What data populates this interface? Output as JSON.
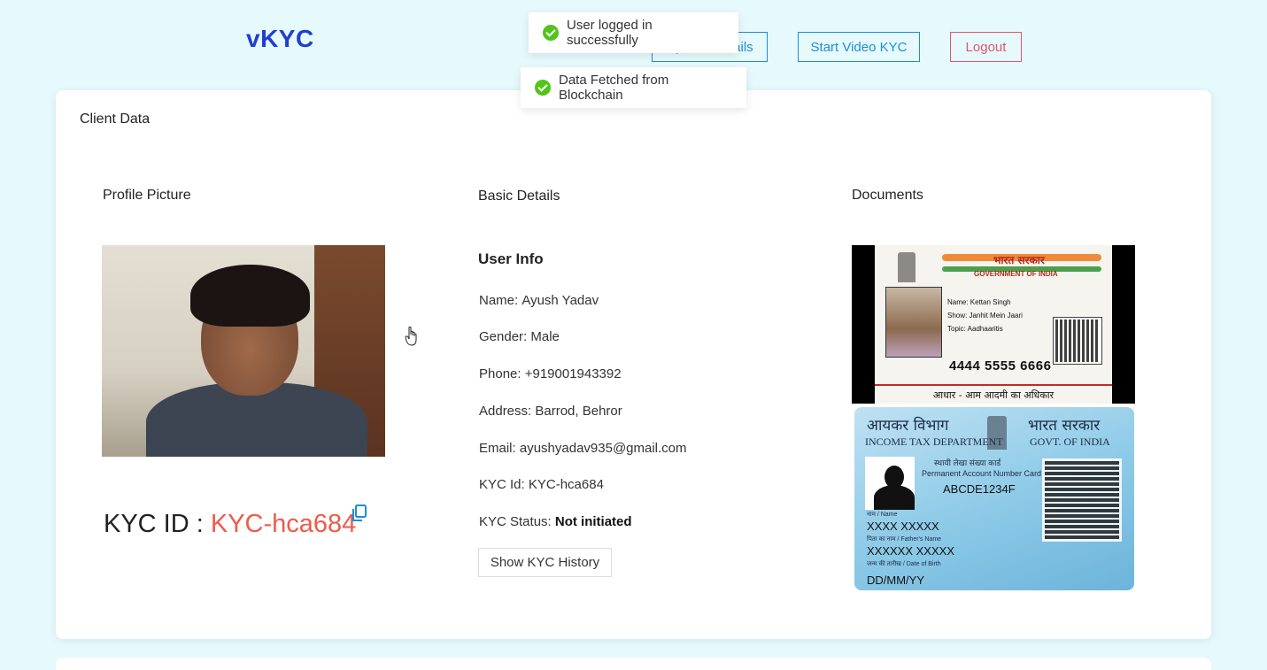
{
  "header": {
    "brand": "vKYC",
    "nav": {
      "update_details_label": "Update Details",
      "start_video_kyc_label": "Start Video KYC",
      "logout_label": "Logout"
    }
  },
  "toasts": [
    {
      "message": "User logged in successfully",
      "icon": "success-check-icon"
    },
    {
      "message": "Data Fetched from Blockchain",
      "icon": "success-check-icon"
    }
  ],
  "client_card": {
    "title": "Client Data",
    "profile": {
      "heading": "Profile Picture",
      "kyc_id_label": "KYC ID :",
      "kyc_id_value": "KYC-hca684",
      "copy_icon": "copy-icon"
    },
    "basic_details": {
      "heading": "Basic Details",
      "user_info_title": "User Info",
      "rows": [
        {
          "label": "Name",
          "sep": ":",
          "value": "Ayush Yadav"
        },
        {
          "label": "Gender",
          "sep": ":",
          "value": "Male"
        },
        {
          "label": "Phone",
          "sep": ":",
          "value": "+919001943392"
        },
        {
          "label": "Address",
          "sep": ":",
          "value": "Barrod, Behror"
        },
        {
          "label": "Email",
          "sep": ":",
          "value": "ayushyadav935@gmail.com"
        },
        {
          "label": "KYC Id",
          "sep": ":",
          "value": "KYC-hca684"
        },
        {
          "label": "KYC Status",
          "sep": ":",
          "value": "Not initiated"
        }
      ],
      "history_button_label": "Show KYC History"
    },
    "documents": {
      "heading": "Documents",
      "aadhaar": {
        "hindi_title": "भारत सरकार",
        "english_title": "GOVERNMENT OF INDIA",
        "name_line": "Name: Kettan Singh",
        "show_line": "Show: Janhit Mein Jaari",
        "topic_line": "Topic: Aadhaaritis",
        "number": "4444 5555 6666",
        "footer": "आधार - आम आदमी का अधिकार"
      },
      "pan": {
        "hindi_left": "आयकर विभाग",
        "hindi_right": "भारत सरकार",
        "english_left": "INCOME TAX DEPARTMENT",
        "english_right": "GOVT. OF INDIA",
        "card_hindi": "स्थायी लेखा संख्या कार्ड",
        "card_english": "Permanent Account Number Card",
        "pan_number": "ABCDE1234F",
        "name_label": "नाम / Name",
        "name_value": "XXXX XXXXX",
        "father_label": "पिता का नाम / Father's Name",
        "father_value": "XXXXXX XXXXX",
        "dob_label": "जन्म की तारीख / Date of Birth",
        "dob_value": "DD/MM/YY"
      }
    }
  }
}
